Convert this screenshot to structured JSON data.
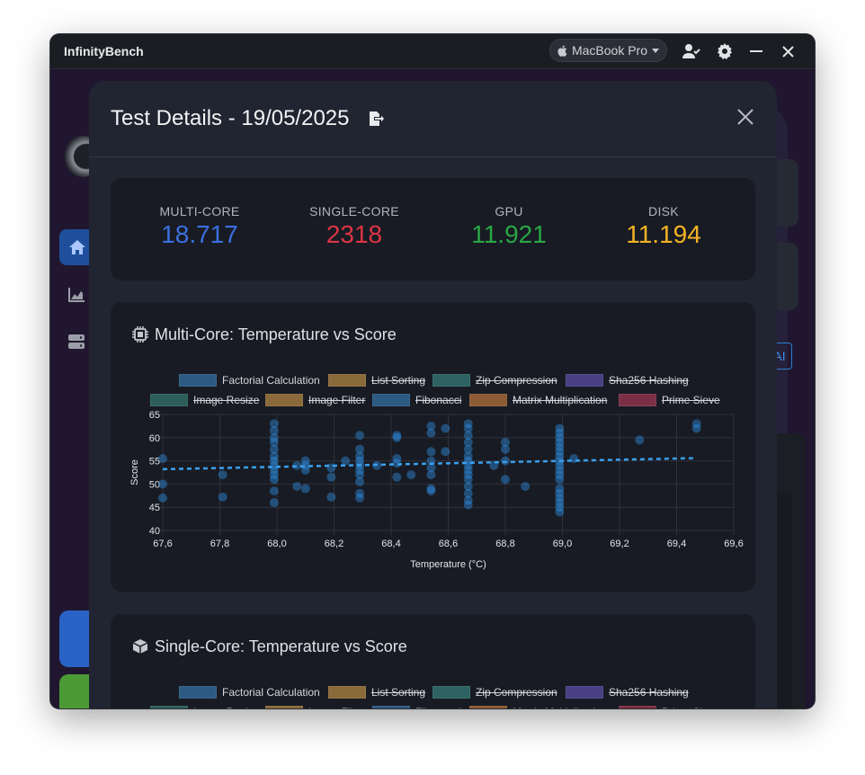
{
  "app": {
    "title": "InfinityBench",
    "device_label": "MacBook Pro"
  },
  "background": {
    "ai_button": "AI"
  },
  "modal": {
    "title": "Test Details - 19/05/2025",
    "stats": [
      {
        "label": "MULTI-CORE",
        "value": "18.717",
        "color": "#3b6fe0"
      },
      {
        "label": "SINGLE-CORE",
        "value": "2318",
        "color": "#dc3545"
      },
      {
        "label": "GPU",
        "value": "11.921",
        "color": "#28a745"
      },
      {
        "label": "DISK",
        "value": "11.194",
        "color": "#f5b325"
      }
    ]
  },
  "legend": [
    {
      "label": "Factorial Calculation",
      "color": "#2c5a82",
      "active": true
    },
    {
      "label": "List Sorting",
      "color": "#8a6a3a",
      "active": false
    },
    {
      "label": "Zip Compression",
      "color": "#2e6262",
      "active": false
    },
    {
      "label": "Sha256 Hashing",
      "color": "#4a3f84",
      "active": false
    },
    {
      "label": "Image Resize",
      "color": "#2c5e5c",
      "active": false
    },
    {
      "label": "Image Filter",
      "color": "#8a6a3a",
      "active": false
    },
    {
      "label": "Fibonacci",
      "color": "#2c5a82",
      "active": false
    },
    {
      "label": "Matrix Multiplication",
      "color": "#8c5a34",
      "active": false
    },
    {
      "label": "Prime Sieve",
      "color": "#7c2f44",
      "active": false
    }
  ],
  "multi_core_card": {
    "title": "Multi-Core: Temperature vs Score"
  },
  "single_core_card": {
    "title": "Single-Core: Temperature vs Score"
  },
  "chart_data": {
    "type": "scatter",
    "title": "Multi-Core: Temperature vs Score",
    "xlabel": "Temperature (°C)",
    "ylabel": "Score",
    "xlim": [
      67.6,
      69.6
    ],
    "ylim": [
      40,
      65
    ],
    "x_ticks": [
      "67,6",
      "67,8",
      "68,0",
      "68,2",
      "68,4",
      "68,6",
      "68,8",
      "69,0",
      "69,2",
      "69,4",
      "69,6"
    ],
    "y_ticks": [
      "65",
      "60",
      "55",
      "50",
      "45",
      "40"
    ],
    "grid": true,
    "point_color": "#2f8fe0",
    "series": [
      {
        "name": "Factorial Calculation",
        "points": [
          [
            67.6,
            55.5
          ],
          [
            67.6,
            50
          ],
          [
            67.6,
            47
          ],
          [
            67.81,
            52
          ],
          [
            67.81,
            47.2
          ],
          [
            67.99,
            63
          ],
          [
            67.99,
            61.5
          ],
          [
            67.99,
            60
          ],
          [
            67.99,
            59
          ],
          [
            67.99,
            57.5
          ],
          [
            67.99,
            56
          ],
          [
            67.99,
            55
          ],
          [
            67.99,
            54
          ],
          [
            67.99,
            53
          ],
          [
            67.99,
            52
          ],
          [
            67.99,
            51
          ],
          [
            67.99,
            48.5
          ],
          [
            67.99,
            46
          ],
          [
            68.07,
            54
          ],
          [
            68.07,
            49.5
          ],
          [
            68.1,
            55
          ],
          [
            68.1,
            54
          ],
          [
            68.1,
            53
          ],
          [
            68.1,
            49
          ],
          [
            68.19,
            53.5
          ],
          [
            68.19,
            51.5
          ],
          [
            68.19,
            47.2
          ],
          [
            68.24,
            55
          ],
          [
            68.29,
            60.5
          ],
          [
            68.29,
            57.5
          ],
          [
            68.29,
            56
          ],
          [
            68.29,
            55
          ],
          [
            68.29,
            54
          ],
          [
            68.29,
            53
          ],
          [
            68.29,
            52
          ],
          [
            68.29,
            50.5
          ],
          [
            68.29,
            48
          ],
          [
            68.29,
            47
          ],
          [
            68.35,
            54
          ],
          [
            68.42,
            60.5
          ],
          [
            68.42,
            60
          ],
          [
            68.42,
            55.5
          ],
          [
            68.42,
            54.5
          ],
          [
            68.42,
            51.5
          ],
          [
            68.47,
            52
          ],
          [
            68.54,
            62.5
          ],
          [
            68.54,
            61
          ],
          [
            68.54,
            57
          ],
          [
            68.54,
            55
          ],
          [
            68.54,
            53.5
          ],
          [
            68.54,
            52
          ],
          [
            68.54,
            49
          ],
          [
            68.54,
            48.5
          ],
          [
            68.59,
            62
          ],
          [
            68.59,
            57
          ],
          [
            68.67,
            63
          ],
          [
            68.67,
            62
          ],
          [
            68.67,
            60.5
          ],
          [
            68.67,
            59
          ],
          [
            68.67,
            57.5
          ],
          [
            68.67,
            56
          ],
          [
            68.67,
            55
          ],
          [
            68.67,
            54
          ],
          [
            68.67,
            53
          ],
          [
            68.67,
            52
          ],
          [
            68.67,
            51
          ],
          [
            68.67,
            49.5
          ],
          [
            68.67,
            48
          ],
          [
            68.67,
            46.5
          ],
          [
            68.67,
            45.5
          ],
          [
            68.76,
            54
          ],
          [
            68.8,
            59
          ],
          [
            68.8,
            57.5
          ],
          [
            68.8,
            55
          ],
          [
            68.8,
            51
          ],
          [
            68.87,
            49.5
          ],
          [
            68.99,
            62
          ],
          [
            68.99,
            61
          ],
          [
            68.99,
            60
          ],
          [
            68.99,
            59
          ],
          [
            68.99,
            58
          ],
          [
            68.99,
            57
          ],
          [
            68.99,
            56
          ],
          [
            68.99,
            55
          ],
          [
            68.99,
            54
          ],
          [
            68.99,
            53
          ],
          [
            68.99,
            52
          ],
          [
            68.99,
            51
          ],
          [
            68.99,
            49
          ],
          [
            68.99,
            48
          ],
          [
            68.99,
            47
          ],
          [
            68.99,
            46
          ],
          [
            68.99,
            45
          ],
          [
            68.99,
            44
          ],
          [
            69.04,
            55.5
          ],
          [
            69.27,
            59.5
          ],
          [
            69.47,
            63
          ],
          [
            69.47,
            62
          ]
        ]
      }
    ],
    "trendline": {
      "from": [
        67.6,
        53.2
      ],
      "to": [
        69.47,
        55.6
      ]
    }
  }
}
